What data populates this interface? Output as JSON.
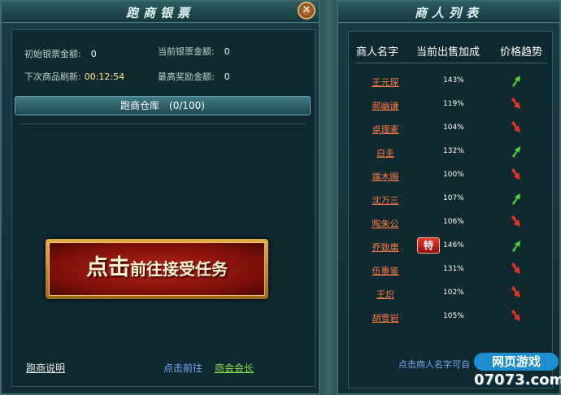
{
  "left_panel": {
    "title": "跑商银票",
    "close_glyph": "✕",
    "stats": {
      "initial_label": "初始银票金额:",
      "initial_value": "0",
      "current_label": "当前银票金额:",
      "current_value": "0",
      "refresh_label": "下次商品刷新:",
      "refresh_value": "00:12:54",
      "max_reward_label": "最高奖励金额:",
      "max_reward_value": "0"
    },
    "warehouse": {
      "label": "跑商仓库",
      "count": "(0/100)"
    },
    "accept_button": {
      "big": "点击",
      "small": "前往接受任务"
    },
    "guide_link": "跑商说明",
    "goto_link": "点击前往",
    "president_link": "商会会长"
  },
  "right_panel": {
    "title": "商人列表",
    "headers": {
      "name": "商人名字",
      "bonus": "当前出售加成",
      "trend": "价格趋势"
    },
    "merchants": [
      {
        "name": "王元琛",
        "percent": "143%",
        "trend": "up",
        "special": ""
      },
      {
        "name": "郝幽谦",
        "percent": "119%",
        "trend": "down",
        "special": ""
      },
      {
        "name": "卓理麦",
        "percent": "104%",
        "trend": "down",
        "special": ""
      },
      {
        "name": "白圭",
        "percent": "132%",
        "trend": "up",
        "special": ""
      },
      {
        "name": "端木赐",
        "percent": "100%",
        "trend": "down",
        "special": ""
      },
      {
        "name": "沈万三",
        "percent": "107%",
        "trend": "up",
        "special": ""
      },
      {
        "name": "陶朱公",
        "percent": "106%",
        "trend": "down",
        "special": ""
      },
      {
        "name": "乔致庸",
        "percent": "146%",
        "trend": "up",
        "special": "特"
      },
      {
        "name": "伍重鉴",
        "percent": "131%",
        "trend": "down",
        "special": ""
      },
      {
        "name": "王炽",
        "percent": "102%",
        "trend": "down",
        "special": ""
      },
      {
        "name": "胡雪岩",
        "percent": "105%",
        "trend": "down",
        "special": ""
      }
    ],
    "footer_hint": "点击商人名字可自"
  },
  "colors": {
    "trend_up": "#4fd43b",
    "trend_down": "#e4341f"
  },
  "watermark": {
    "top": "网页游戏",
    "bottom": "07073.com"
  }
}
